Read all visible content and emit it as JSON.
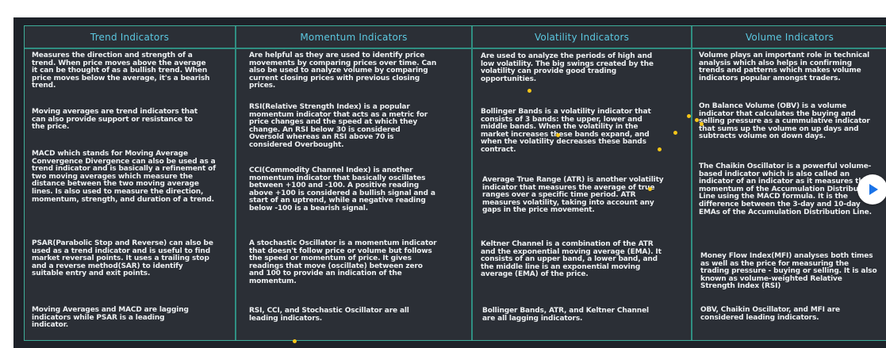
{
  "columns": [
    {
      "title": "Trend Indicators",
      "paragraphs": [
        "Measures the direction and strength of a trend. When price moves above the average it can be thought of as a bullish trend. When price moves below the average, it's a bearish trend.",
        "Moving averages are trend indicators that can also provide support or resistance to the price.",
        "MACD which stands for Moving Average Convergence Divergence can also be used as a trend indicator and is basically a refinement of two moving averages which measure the distance between the two moving average lines. Is also used to measure the direction, momentum, strength, and duration of a trend.",
        "PSAR(Parabolic Stop and Reverse) can also be used as a trend indicator and is useful to find market reversal points. It uses a trailing stop and a reverse method(SAR) to identify suitable entry and exit points.",
        "Moving Averages and MACD are lagging indicators while PSAR is a leading indicator."
      ]
    },
    {
      "title": "Momentum Indicators",
      "paragraphs": [
        "Are helpful as they are used to identify price movements by comparing prices over time. Can also be used to analyze volume by comparing current closing prices with previous closing prices.",
        "RSI(Relative Strength Index) is a popular momentum indicator that acts as a metric for price changes and the speed at which they change. An RSI below 30 is considered Oversold whereas an RSI above 70 is considered Overbought.",
        "CCI(Commodity Channel Index) is another momentum indicator that basically oscillates between +100 and -100. A positive reading above +100 is considered a bullish signal and a start of an uptrend, while a negative reading below -100 is a bearish signal.",
        "A stochastic Oscillator is a momentum indicator that doesn't follow price or volume but follows the speed or momentum of price. It gives readings that move (oscillate) between zero and 100 to provide an indication of the momentum.",
        "RSI, CCI, and Stochastic Oscillator are all leading indicators."
      ]
    },
    {
      "title": "Volatility Indicators",
      "paragraphs": [
        "Are used to analyze the periods of high and low volatility. The big swings created by the volatility can provide good trading opportunities.",
        "Bollinger Bands is a volatility indicator that consists of 3 bands: the upper, lower and middle bands. When the volatility in the market increases these bands expand, and when the volatility decreases these bands contract.",
        "Average True Range (ATR) is another volatility indicator that measures the average of true ranges over a specific time period. ATR measures volatility, taking into account any gaps in the price movement.",
        "Keltner Channel is a combination of the ATR and the exponential moving average (EMA). It consists of an upper band, a lower band, and the middle line is an exponential moving average (EMA) of the price.",
        "Bollinger Bands, ATR, and Keltner Channel are all lagging indicators."
      ]
    },
    {
      "title": "Volume Indicators",
      "paragraphs": [
        "Volume plays an important role in technical analysis which also helps in confirming trends and patterns which makes volume indicators popular amongst traders.",
        "On Balance Volume (OBV) is a volume indicator that calculates the buying and selling pressure as a cummulative indicator that sums up the volume on up days and subtracts volume on down days.",
        "The Chaikin Oscillator is a powerful volume-based indicator which is also called an indicator of an indicator as it measures the momentum of the Accumulation Distribution Line using the MACD formula. It is the difference between the 3-day and 10-day EMAs of the Accumulation Distribution Line.",
        "Money Flow Index(MFI) analyses both times as well as the price for measuring the trading pressure - buying or selling. It is also known as volume-weighted Relative Strength Index (RSI)",
        "OBV, Chaikin Oscillator, and MFI are considered leading indicators."
      ]
    }
  ],
  "colors": {
    "frame_background": "#1e2229",
    "board_background": "#2b2f36",
    "grid_line": "#2f8f82",
    "heading": "#5bc8e0",
    "body_text": "#eef1f3",
    "pointer_dot": "#f5c518",
    "play_button": "#1a73e8"
  },
  "icons": {
    "play_button": "play-icon"
  }
}
